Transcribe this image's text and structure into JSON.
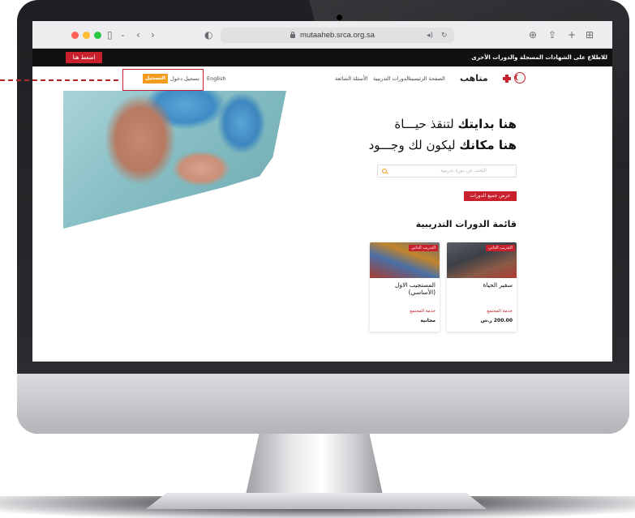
{
  "browser": {
    "address": "mutaaheb.srca.org.sa",
    "icons": [
      "sidebar-icon",
      "back-icon",
      "forward-icon",
      "shield-icon",
      "lock-icon",
      "audio-icon",
      "reload-icon",
      "download-icon",
      "share-icon",
      "new-tab-icon",
      "tabs-grid-icon"
    ]
  },
  "promo_bar": {
    "text": "للاطلاع على الشهادات المسجلة والدورات الأخرى",
    "button": "اضغط هنا"
  },
  "nav": {
    "logo": "متاهب",
    "links": {
      "home": "الصفحة الرئيسية",
      "courses": "الدورات التدريبية",
      "faq": "الأسئلة الشائعة"
    },
    "language": "English",
    "login": "تسجيل دخول",
    "register": "التسجيل"
  },
  "hero": {
    "line1_bold": "هنا بدايتك",
    "line1_rest": "لتنقذ حيـــاة",
    "line2_bold": "هنا مكانك",
    "line2_rest": "ليكون لك وجـــود",
    "search_placeholder": "البحث عن دورة تدريبية",
    "button": "عرض جميع الدورات"
  },
  "courses": {
    "title": "قائمة الدورات التدريبية",
    "cards": [
      {
        "badge": "التدريب الذاتي",
        "title": "سفير الحياة",
        "category": "خدمة المجتمع",
        "price": "200.00 ر.س"
      },
      {
        "badge": "التدريب الذاتي",
        "title": "المستجيب الاول (الأساسي)",
        "category": "خدمة المجتمع",
        "price": "مجانية"
      }
    ]
  },
  "colors": {
    "brand_red": "#c8202d",
    "accent_orange": "#f39c1e"
  }
}
